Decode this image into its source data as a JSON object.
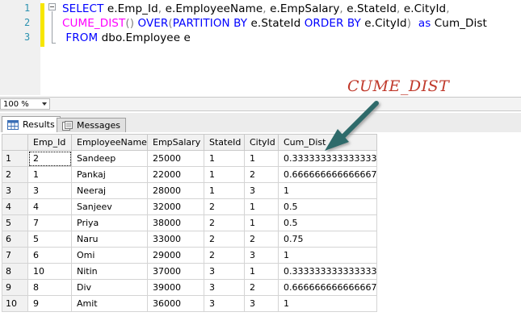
{
  "editor": {
    "line_numbers": [
      "1",
      "2",
      "3"
    ],
    "lines": [
      [
        {
          "t": "SELECT",
          "c": "kw"
        },
        {
          "t": " e.Emp_Id",
          "c": "tx"
        },
        {
          "t": ",",
          "c": "gr"
        },
        {
          "t": " e.EmployeeName",
          "c": "tx"
        },
        {
          "t": ",",
          "c": "gr"
        },
        {
          "t": " e.EmpSalary",
          "c": "tx"
        },
        {
          "t": ",",
          "c": "gr"
        },
        {
          "t": " e.StateId",
          "c": "tx"
        },
        {
          "t": ",",
          "c": "gr"
        },
        {
          "t": " e.CityId",
          "c": "tx"
        },
        {
          "t": ",",
          "c": "gr"
        }
      ],
      [
        {
          "t": "CUME_DIST",
          "c": "fn"
        },
        {
          "t": "()",
          "c": "gr"
        },
        {
          "t": " OVER",
          "c": "kw"
        },
        {
          "t": "(",
          "c": "gr"
        },
        {
          "t": "PARTITION BY",
          "c": "kw"
        },
        {
          "t": " e.StateId ",
          "c": "tx"
        },
        {
          "t": "ORDER BY",
          "c": "kw"
        },
        {
          "t": " e.CityId",
          "c": "tx"
        },
        {
          "t": ")",
          "c": "gr"
        },
        {
          "t": "  as",
          "c": "kw"
        },
        {
          "t": " Cum_Dist",
          "c": "tx"
        }
      ],
      [
        {
          "t": " FROM",
          "c": "kw"
        },
        {
          "t": " dbo.Employee e",
          "c": "tx"
        }
      ]
    ],
    "annotation": "CUME_DIST"
  },
  "zoom": {
    "value": "100 %"
  },
  "tabs": [
    {
      "label": "Results",
      "icon": "grid-icon"
    },
    {
      "label": "Messages",
      "icon": "messages-icon"
    }
  ],
  "results": {
    "columns": [
      "Emp_Id",
      "EmployeeName",
      "EmpSalary",
      "StateId",
      "CityId",
      "Cum_Dist"
    ],
    "rows": [
      [
        "1",
        "2",
        "Sandeep",
        "25000",
        "1",
        "1",
        "0.333333333333333"
      ],
      [
        "2",
        "1",
        "Pankaj",
        "22000",
        "1",
        "2",
        "0.666666666666667"
      ],
      [
        "3",
        "3",
        "Neeraj",
        "28000",
        "1",
        "3",
        "1"
      ],
      [
        "4",
        "4",
        "Sanjeev",
        "32000",
        "2",
        "1",
        "0.5"
      ],
      [
        "5",
        "7",
        "Priya",
        "38000",
        "2",
        "1",
        "0.5"
      ],
      [
        "6",
        "5",
        "Naru",
        "33000",
        "2",
        "2",
        "0.75"
      ],
      [
        "7",
        "6",
        "Omi",
        "29000",
        "2",
        "3",
        "1"
      ],
      [
        "8",
        "10",
        "Nitin",
        "37000",
        "3",
        "1",
        "0.333333333333333"
      ],
      [
        "9",
        "8",
        "Div",
        "39000",
        "3",
        "2",
        "0.666666666666667"
      ],
      [
        "10",
        "9",
        "Amit",
        "36000",
        "3",
        "3",
        "1"
      ]
    ]
  },
  "colors": {
    "keyword": "#0000ff",
    "function": "#ff00ff",
    "annotation": "#c0392b",
    "arrow": "#2e6b6b"
  }
}
